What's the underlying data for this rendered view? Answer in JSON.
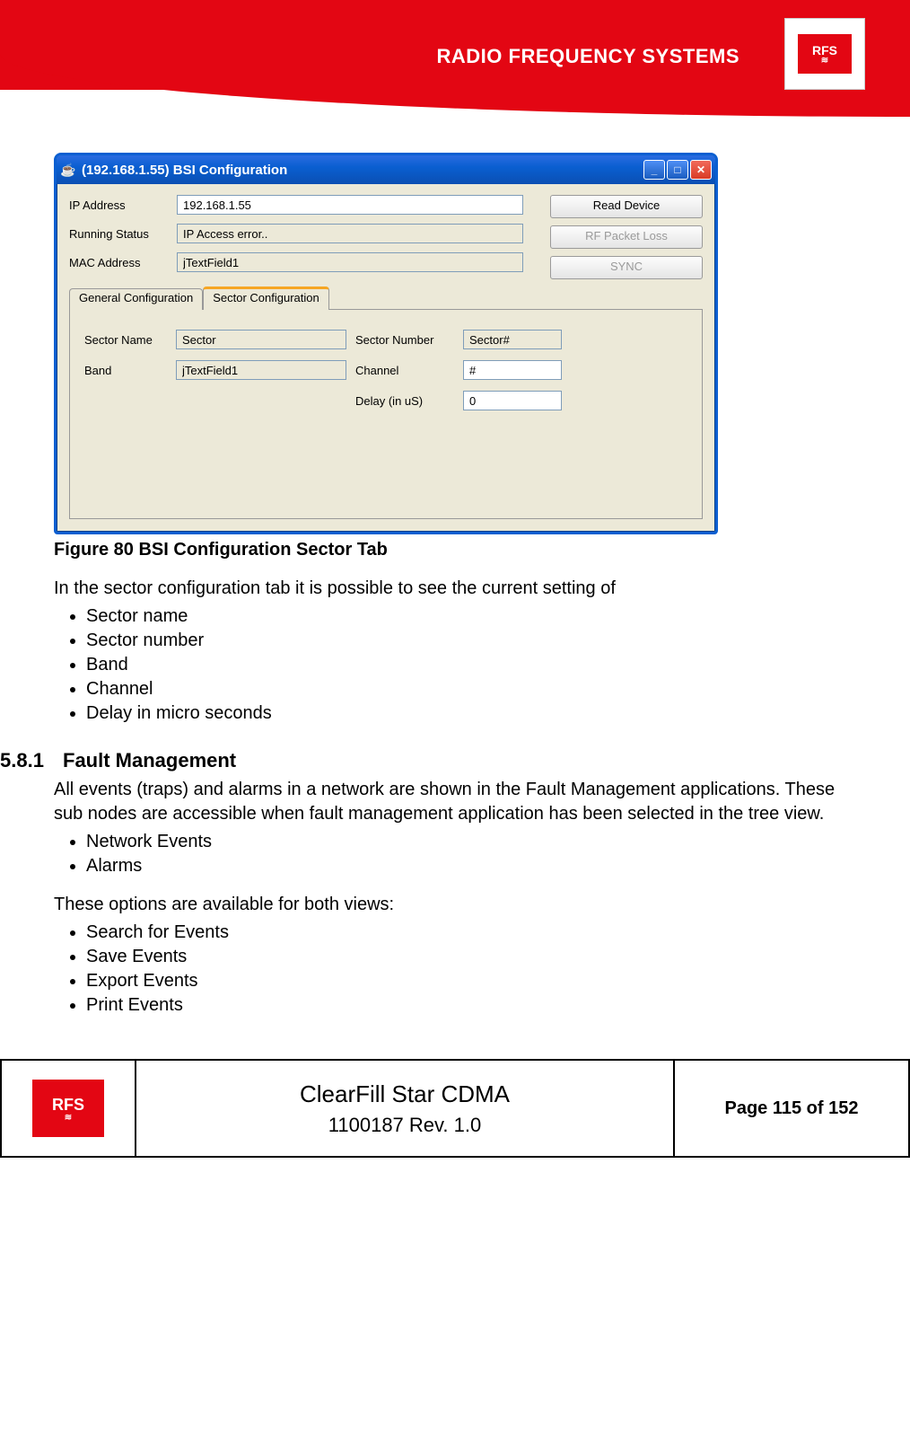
{
  "header": {
    "brand_text": "RADIO FREQUENCY SYSTEMS",
    "logo_text": "RFS"
  },
  "window": {
    "title": "(192.168.1.55) BSI Configuration",
    "fields": {
      "ip_label": "IP Address",
      "ip_value": "192.168.1.55",
      "rs_label": "Running Status",
      "rs_value": "IP Access error..",
      "mac_label": "MAC Address",
      "mac_value": "jTextField1"
    },
    "buttons": {
      "read": "Read Device",
      "rfpl": "RF Packet Loss",
      "sync": "SYNC"
    },
    "tabs": {
      "general": "General Configuration",
      "sector": "Sector Configuration"
    },
    "sector": {
      "sector_name_label": "Sector Name",
      "sector_name_value": "Sector",
      "sector_num_label": "Sector Number",
      "sector_num_value": "Sector#",
      "band_label": "Band",
      "band_value": "jTextField1",
      "channel_label": "Channel",
      "channel_value": "#",
      "delay_label": "Delay (in uS)",
      "delay_value": "0"
    }
  },
  "doc": {
    "caption": "Figure 80 BSI Configuration Sector Tab",
    "intro": "In the sector configuration tab it is possible to see the current setting of",
    "bullets1": [
      "Sector name",
      "Sector number",
      "Band",
      "Channel",
      "Delay in micro seconds"
    ],
    "section_num": "5.8.1",
    "section_title": "Fault Management",
    "para1": "All events (traps) and alarms in a network are shown in the Fault Management applications. These sub nodes are accessible when fault management application has been selected in the tree view.",
    "bullets2": [
      "Network Events",
      "Alarms"
    ],
    "para2": "These options are available for both views:",
    "bullets3": [
      "Search for Events",
      "Save Events",
      "Export Events",
      "Print Events"
    ]
  },
  "footer": {
    "logo_text": "RFS",
    "title": "ClearFill Star CDMA",
    "subtitle": "1100187 Rev. 1.0",
    "page": "Page 115 of 152"
  }
}
